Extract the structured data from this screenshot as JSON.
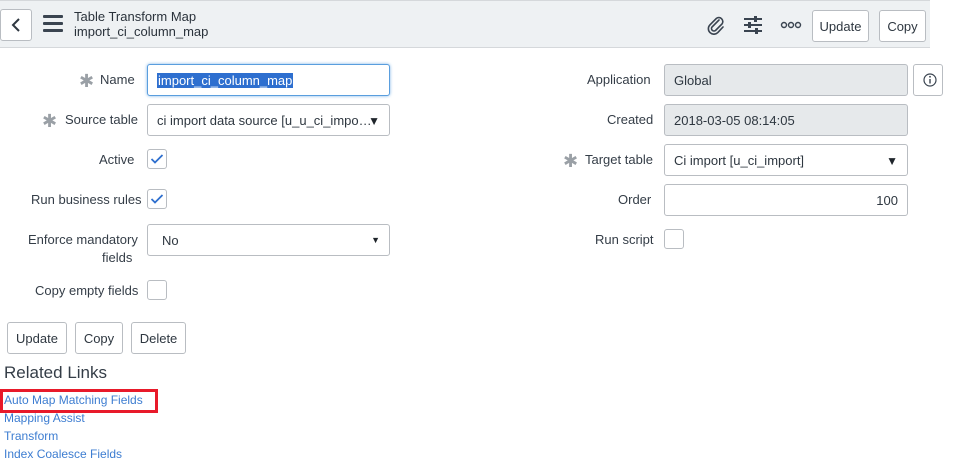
{
  "header": {
    "title": "Table Transform Map",
    "subtitle": "import_ci_column_map",
    "update_label": "Update",
    "copy_label": "Copy",
    "icons": [
      "back-icon",
      "menu-icon",
      "paperclip-icon",
      "sliders-icon",
      "more-icon"
    ]
  },
  "form": {
    "name_label": "Name",
    "name_value": "import_ci_column_map",
    "source_table_label": "Source table",
    "source_table_value": "ci import data source [u_u_ci_impo…",
    "active_label": "Active",
    "active_checked": true,
    "run_business_rules_label": "Run business rules",
    "run_business_rules_checked": true,
    "enforce_mandatory_label_1": "Enforce mandatory",
    "enforce_mandatory_label_2": "fields",
    "enforce_mandatory_value": "No",
    "copy_empty_fields_label": "Copy empty fields",
    "copy_empty_fields_checked": false,
    "application_label": "Application",
    "application_value": "Global",
    "created_label": "Created",
    "created_value": "2018-03-05 08:14:05",
    "target_table_label": "Target table",
    "target_table_value": "Ci import [u_ci_import]",
    "order_label": "Order",
    "order_value": "100",
    "run_script_label": "Run script",
    "run_script_checked": false
  },
  "actions": {
    "update_label": "Update",
    "copy_label": "Copy",
    "delete_label": "Delete"
  },
  "related_links": {
    "title": "Related Links",
    "items": [
      "Auto Map Matching Fields",
      "Mapping Assist",
      "Transform",
      "Index Coalesce Fields"
    ]
  },
  "colors": {
    "link": "#3d7dd1",
    "highlight": "#e81a2a",
    "check": "#2e6fcf",
    "header_bg": "#eef1f3"
  }
}
